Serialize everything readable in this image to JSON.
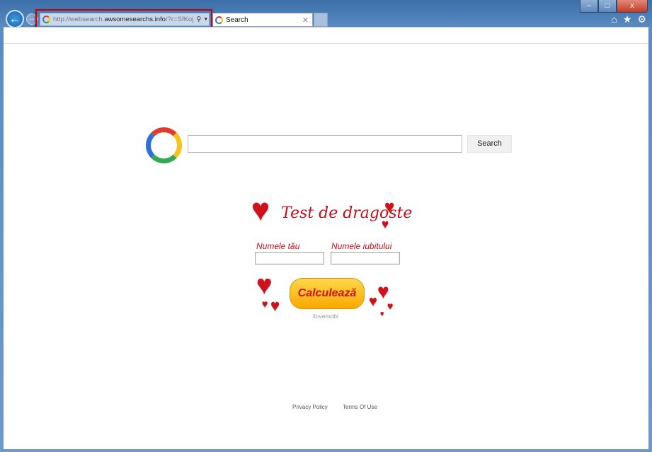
{
  "browser": {
    "address_prefix": "http://websearch.",
    "address_domain": "awsomesearchs.info",
    "address_suffix": "/?r=SfKoj",
    "tab_title": "Search",
    "icons": [
      "back-icon",
      "forward-icon",
      "search-icon",
      "refresh-icon",
      "close-icon",
      "home-icon",
      "star-icon",
      "gear-icon"
    ],
    "window_controls": {
      "minimize": "–",
      "maximize": "□",
      "close": "x"
    },
    "highlight_color": "#cc0000"
  },
  "search": {
    "button_label": "Search",
    "input_value": ""
  },
  "widget": {
    "title": "Test de dragoste",
    "label_your_name": "Numele tău",
    "label_partner_name": "Numele iubitului",
    "button_label": "Calculează",
    "credit": "ilovemobi"
  },
  "footer": {
    "privacy": "Privacy Policy",
    "terms": "Terms Of Use"
  }
}
